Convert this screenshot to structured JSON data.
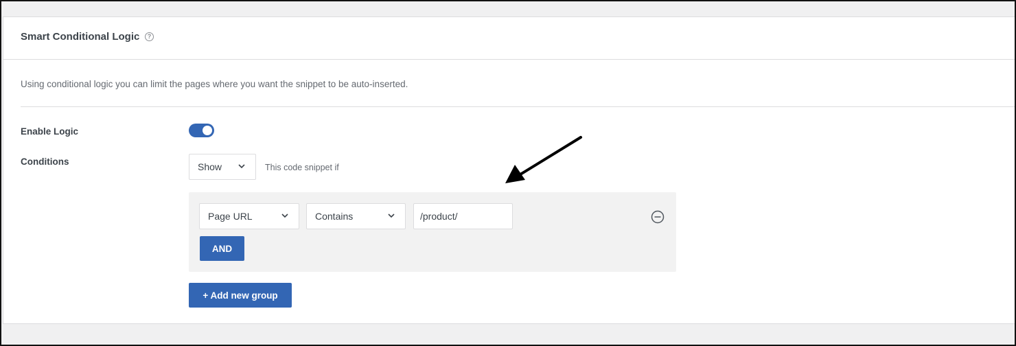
{
  "panel": {
    "title": "Smart Conditional Logic",
    "help_icon": "question-circle-icon",
    "description": "Using conditional logic you can limit the pages where you want the snippet to be auto-inserted."
  },
  "enable_logic": {
    "label": "Enable Logic",
    "enabled": true
  },
  "conditions": {
    "label": "Conditions",
    "show_select": "Show",
    "note": "This code snippet if",
    "group": {
      "field": "Page URL",
      "operator": "Contains",
      "value": "/product/",
      "and_label": "AND",
      "remove_icon": "minus-circle-icon"
    },
    "add_group_label": "+ Add new group"
  },
  "colors": {
    "accent": "#3366b4",
    "page_background": "#f0f0f1",
    "group_background": "#f2f2f2",
    "annotation_arrow": "#000000"
  }
}
